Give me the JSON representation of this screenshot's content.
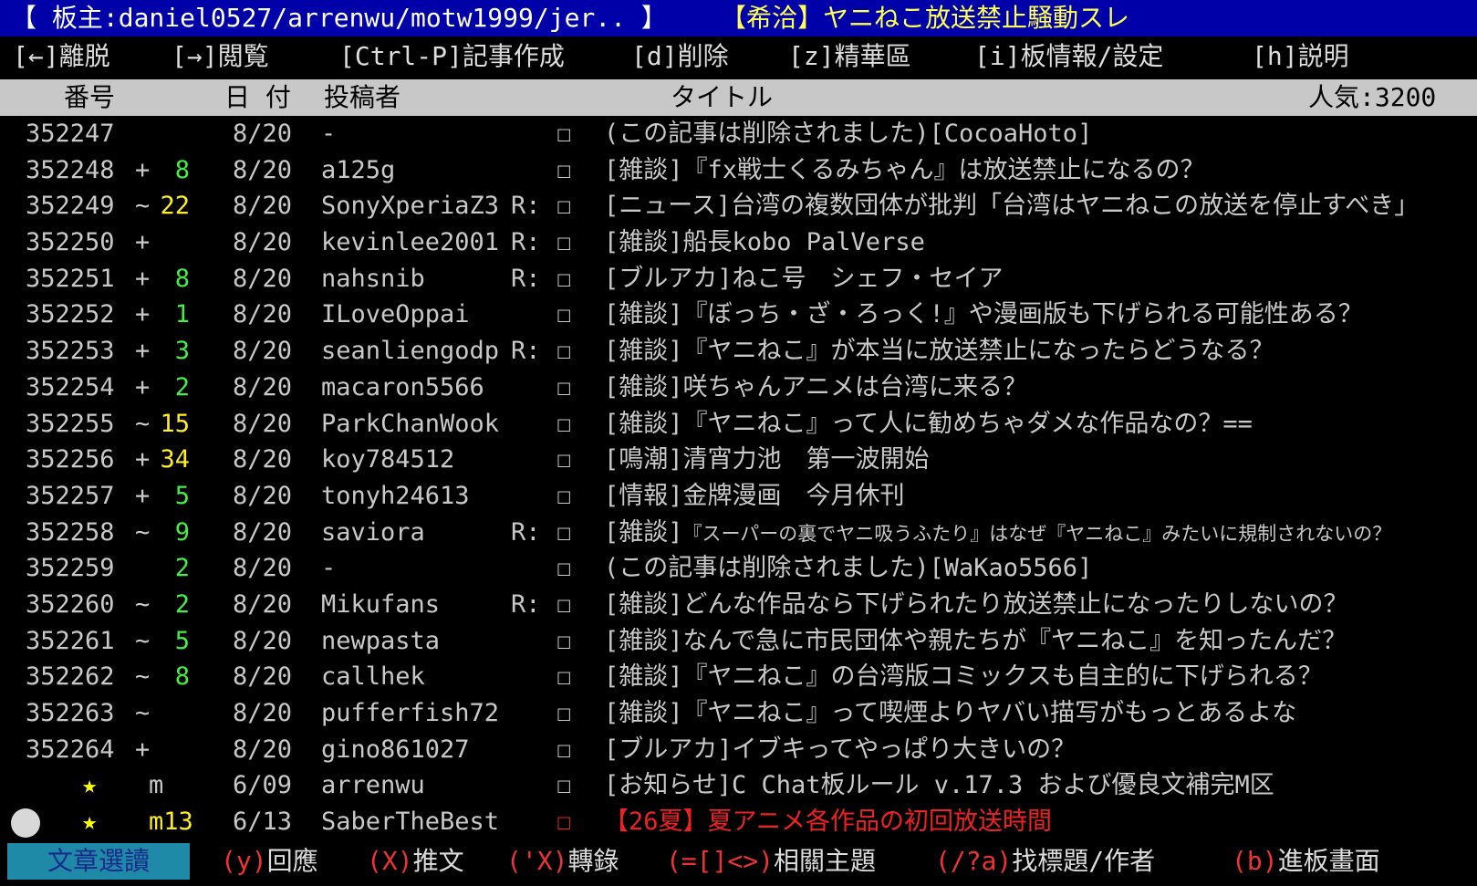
{
  "title_bar": {
    "board_info": "【 板主:daniel0527/arrenwu/motw1999/jer.. 】",
    "thread_title": "【希洽】ヤニねこ放送禁止騒動スレ"
  },
  "menu": [
    "[←]離脱",
    "[→]閲覧",
    "[Ctrl-P]記事作成",
    "[d]削除",
    "[z]精華區",
    "[i]板情報/設定",
    "[h]説明"
  ],
  "header": {
    "num": "番号",
    "date": "日 付",
    "author": "投稿者",
    "title": "タイトル",
    "popularity": "人気:3200"
  },
  "rows": [
    {
      "num": "352247",
      "mark": "",
      "count": "",
      "count_color": "",
      "date": "8/20",
      "author": "-",
      "reply": "",
      "box": "☐",
      "title": "(この記事は削除されました)[CocoaHoto]"
    },
    {
      "num": "352248",
      "mark": "+",
      "count": "8",
      "count_color": "g",
      "date": "8/20",
      "author": "a125g",
      "reply": "",
      "box": "☐",
      "title": "[雑談]『fx戦士くるみちゃん』は放送禁止になるの？"
    },
    {
      "num": "352249",
      "mark": "~",
      "count": "22",
      "count_color": "y",
      "date": "8/20",
      "author": "SonyXperiaZ3",
      "reply": "R:",
      "box": "☐",
      "title": "[ニュース]台湾の複数団体が批判「台湾はヤニねこの放送を停止すべき」"
    },
    {
      "num": "352250",
      "mark": "+",
      "count": "",
      "count_color": "",
      "date": "8/20",
      "author": "kevinlee2001",
      "reply": "R:",
      "box": "☐",
      "title": "[雑談]船長kobo PalVerse"
    },
    {
      "num": "352251",
      "mark": "+",
      "count": "8",
      "count_color": "g",
      "date": "8/20",
      "author": "nahsnib",
      "reply": "R:",
      "box": "☐",
      "title": "[ブルアカ]ねこ号　シェフ・セイア"
    },
    {
      "num": "352252",
      "mark": "+",
      "count": "1",
      "count_color": "g",
      "date": "8/20",
      "author": "ILoveOppai",
      "reply": "",
      "box": "☐",
      "title": "[雑談]『ぼっち・ざ・ろっく!』や漫画版も下げられる可能性ある？"
    },
    {
      "num": "352253",
      "mark": "+",
      "count": "3",
      "count_color": "g",
      "date": "8/20",
      "author": "seanliengodp",
      "reply": "R:",
      "box": "☐",
      "title": "[雑談]『ヤニねこ』が本当に放送禁止になったらどうなる？"
    },
    {
      "num": "352254",
      "mark": "+",
      "count": "2",
      "count_color": "g",
      "date": "8/20",
      "author": "macaron5566",
      "reply": "",
      "box": "☐",
      "title": "[雑談]咲ちゃんアニメは台湾に来る？"
    },
    {
      "num": "352255",
      "mark": "~",
      "count": "15",
      "count_color": "y",
      "date": "8/20",
      "author": "ParkChanWook",
      "reply": "",
      "box": "☐",
      "title": "[雑談]『ヤニねこ』って人に勧めちゃダメな作品なの？=="
    },
    {
      "num": "352256",
      "mark": "+",
      "count": "34",
      "count_color": "y",
      "date": "8/20",
      "author": "koy784512",
      "reply": "",
      "box": "☐",
      "title": "[鳴潮]清宵力池　第一波開始"
    },
    {
      "num": "352257",
      "mark": "+",
      "count": "5",
      "count_color": "g",
      "date": "8/20",
      "author": "tonyh24613",
      "reply": "",
      "box": "☐",
      "title": "[情報]金牌漫画　今月休刊"
    },
    {
      "num": "352258",
      "mark": "~",
      "count": "9",
      "count_color": "g",
      "date": "8/20",
      "author": "saviora",
      "reply": "R:",
      "box": "☐",
      "title_tag": "[雑談]",
      "title_small": "『スーパーの裏でヤニ吸うふたり』はなぜ『ヤニねこ』みたいに規制されないの？"
    },
    {
      "num": "352259",
      "mark": "",
      "count": "2",
      "count_color": "g",
      "date": "8/20",
      "author": "-",
      "reply": "",
      "box": "☐",
      "title": "(この記事は削除されました)[WaKao5566]"
    },
    {
      "num": "352260",
      "mark": "~",
      "count": "2",
      "count_color": "g",
      "date": "8/20",
      "author": "Mikufans",
      "reply": "R:",
      "box": "☐",
      "title": "[雑談]どんな作品なら下げられたり放送禁止になったりしないの？"
    },
    {
      "num": "352261",
      "mark": "~",
      "count": "5",
      "count_color": "g",
      "date": "8/20",
      "author": "newpasta",
      "reply": "",
      "box": "☐",
      "title": "[雑談]なんで急に市民団体や親たちが『ヤニねこ』を知ったんだ？"
    },
    {
      "num": "352262",
      "mark": "~",
      "count": "8",
      "count_color": "g",
      "date": "8/20",
      "author": "callhek",
      "reply": "",
      "box": "☐",
      "title": "[雑談]『ヤニねこ』の台湾版コミックスも自主的に下げられる？"
    },
    {
      "num": "352263",
      "mark": "~",
      "count": "",
      "count_color": "",
      "date": "8/20",
      "author": "pufferfish72",
      "reply": "",
      "box": "☐",
      "title": "[雑談]『ヤニねこ』って喫煙よりヤバい描写がもっとあるよな"
    },
    {
      "num": "352264",
      "mark": "+",
      "count": "",
      "count_color": "",
      "date": "8/20",
      "author": "gino861027",
      "reply": "",
      "box": "☐",
      "title": "[ブルアカ]イブキってやっぱり大きいの？"
    }
  ],
  "pinned": [
    {
      "star": "★",
      "mark": "m",
      "date": "6/09",
      "author": "arrenwu",
      "box": "☐",
      "title": "[お知らせ]C Chat板ルール v.17.3 および優良文補完M区",
      "color": "normal"
    },
    {
      "star": "★",
      "mark": "m13",
      "date": "6/13",
      "author": "SaberTheBest",
      "box": "☐",
      "title": "【26夏】夏アニメ各作品の初回放送時間",
      "color": "red"
    }
  ],
  "status_bar": {
    "mode": "文章選讀",
    "commands": [
      {
        "key": "(y)",
        "label": "回應"
      },
      {
        "key": "(X)",
        "label": "推文"
      },
      {
        "key": "('X)",
        "label": "轉錄"
      },
      {
        "key": "(=[]<>)",
        "label": "相關主題"
      },
      {
        "key": "(/?a)",
        "label": "找標題/作者"
      },
      {
        "key": "(b)",
        "label": "進板畫面"
      }
    ]
  },
  "colors": {
    "title_bg": "#0000a8",
    "header_bg": "#c8c8c8",
    "push_green": "#44ee44",
    "push_yellow": "#ffee22",
    "status_mode_bg": "#1e8aa8",
    "red": "#ee2222"
  }
}
